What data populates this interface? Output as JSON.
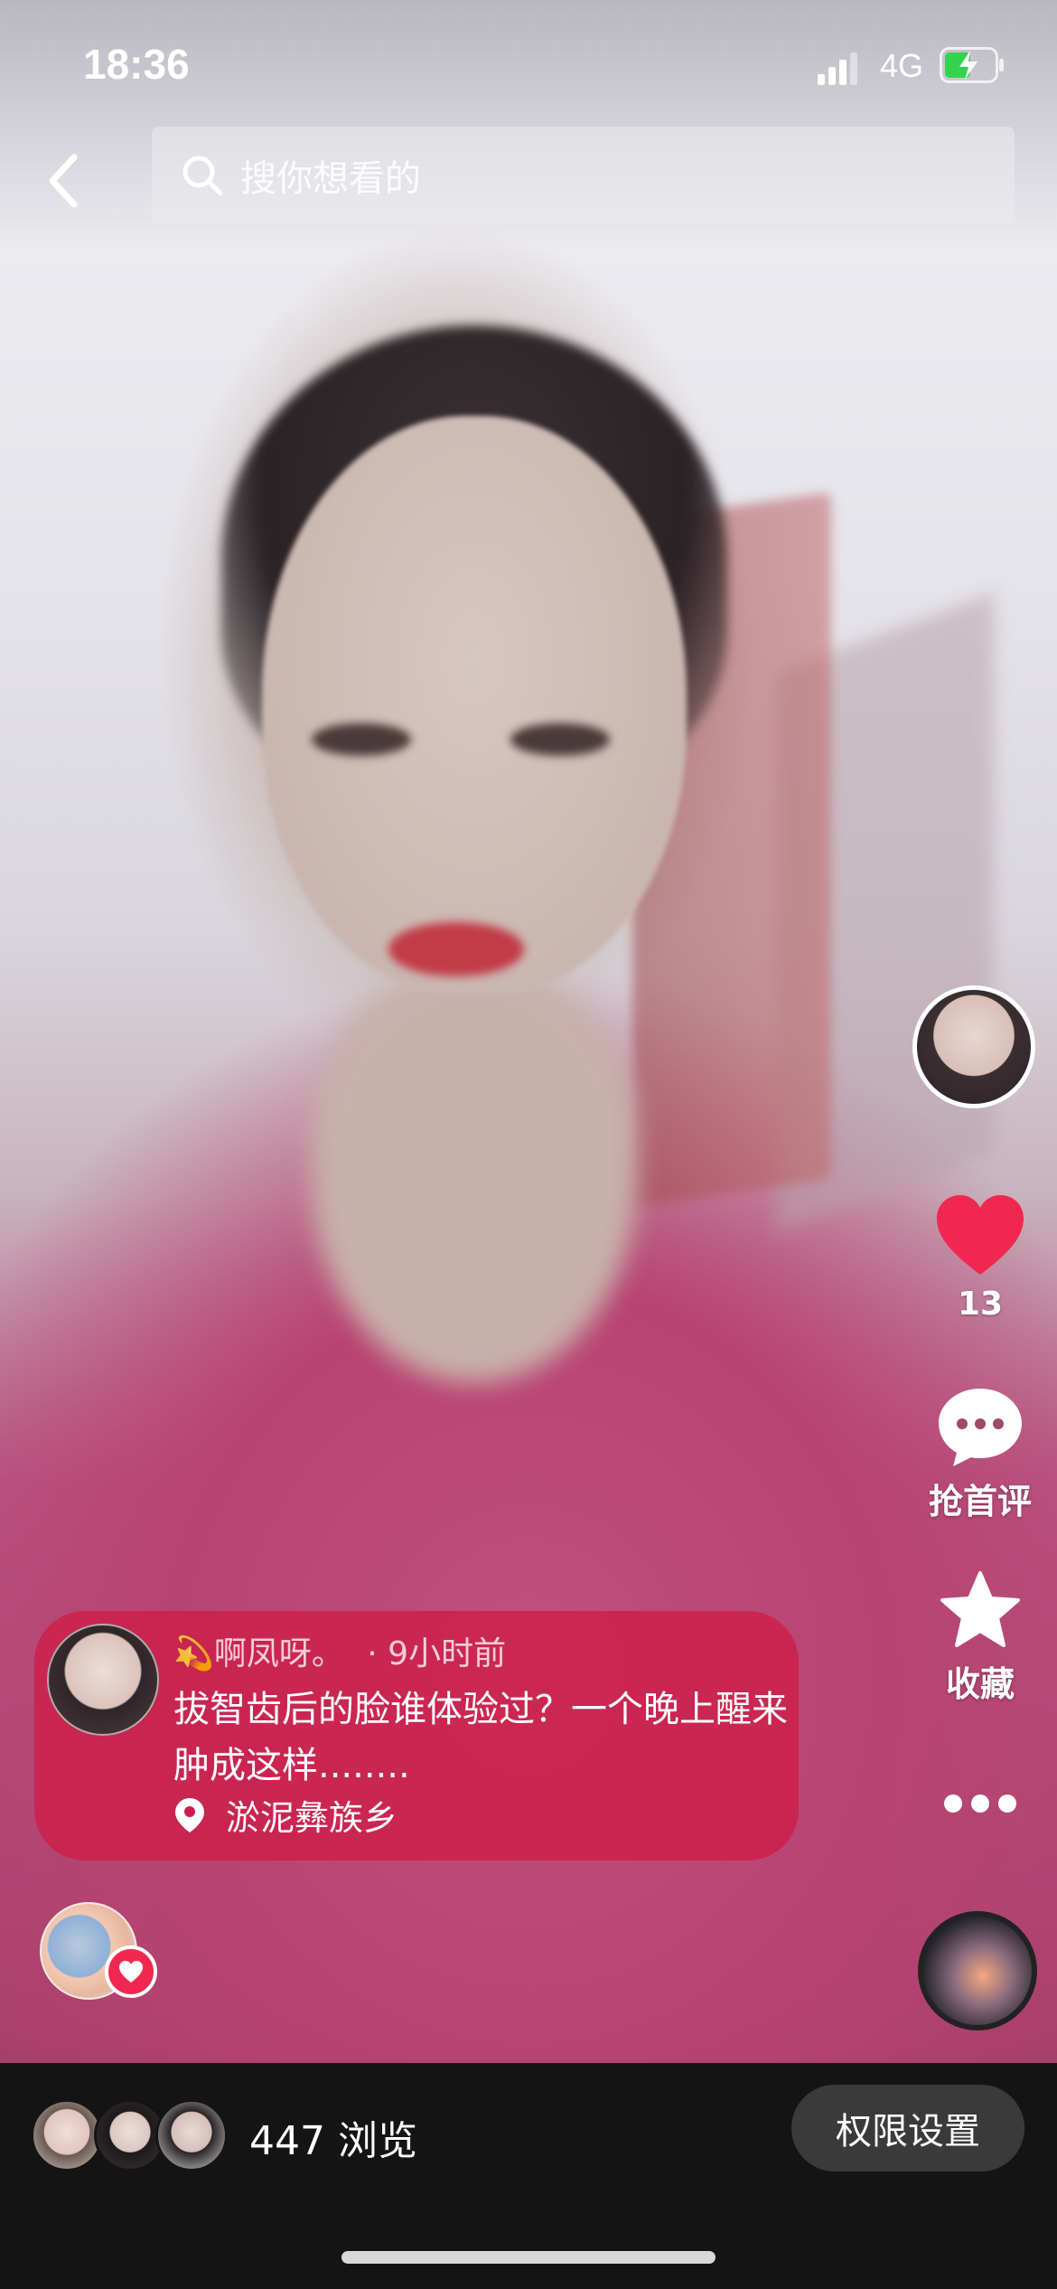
{
  "status": {
    "time": "18:36",
    "network": "4G"
  },
  "search": {
    "placeholder": "搜你想看的"
  },
  "rail": {
    "like_count": "13",
    "comment_label": "抢首评",
    "favorite_label": "收藏"
  },
  "post": {
    "author": "啊凤呀。",
    "time_ago": "· 9小时前",
    "title": "拔智齿后的脸谁体验过？一个晚上醒来肿成这样........",
    "location": "淤泥彝族乡"
  },
  "bottom": {
    "views": "447 浏览",
    "permission_button": "权限设置"
  },
  "colors": {
    "accent": "#f0284f",
    "card": "#cd1e4b",
    "bottom_bg": "#141414"
  }
}
